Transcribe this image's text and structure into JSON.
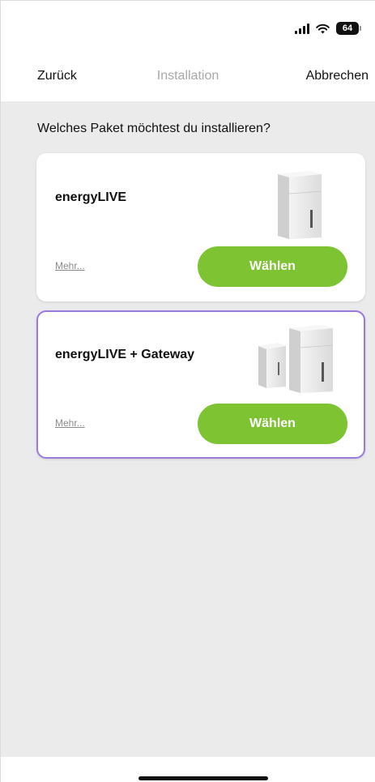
{
  "status_bar": {
    "battery_level": "64",
    "icons": [
      "signal-icon",
      "wifi-icon",
      "battery-icon"
    ]
  },
  "nav": {
    "back_label": "Zurück",
    "title": "Installation",
    "cancel_label": "Abbrechen"
  },
  "page": {
    "question": "Welches Paket möchtest du installieren?"
  },
  "packages": [
    {
      "title": "energyLIVE",
      "more_label": "Mehr...",
      "select_label": "Wählen",
      "selected": false,
      "image": "energylive-device-image"
    },
    {
      "title": "energyLIVE + Gateway",
      "more_label": "Mehr...",
      "select_label": "Wählen",
      "selected": true,
      "image": "energylive-gateway-devices-image"
    }
  ],
  "colors": {
    "accent_green": "#7ec332",
    "selected_border": "#9b7ae0",
    "background": "#ebebeb"
  }
}
